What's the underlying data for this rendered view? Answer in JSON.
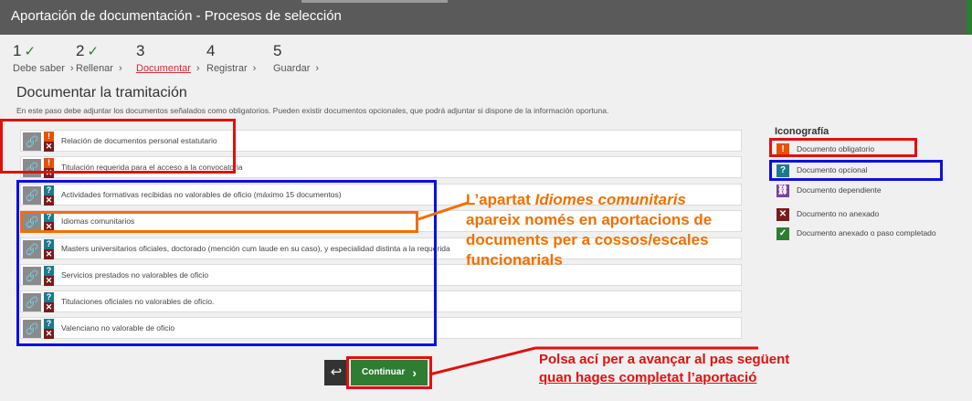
{
  "window": {
    "title": "Aportación de documentación - Procesos de selección"
  },
  "steps": [
    {
      "num": "1",
      "done": "✓",
      "label": "Debe saber",
      "sep": "›"
    },
    {
      "num": "2",
      "done": "✓",
      "label": "Rellenar",
      "sep": "›"
    },
    {
      "num": "3",
      "done": "",
      "label": "Documentar",
      "sep": "›"
    },
    {
      "num": "4",
      "done": "",
      "label": "Registrar",
      "sep": "›"
    },
    {
      "num": "5",
      "done": "",
      "label": "Guardar",
      "sep": "›"
    }
  ],
  "section": {
    "title": "Documentar la tramitación",
    "description": "En este paso debe adjuntar los documentos señalados como obligatorios. Pueden existir documentos opcionales, que podrá adjuntar si dispone de la información oportuna."
  },
  "documents": [
    {
      "label": "Relación de documentos personal estatutario",
      "type": "!"
    },
    {
      "label": "Titulación requerida para el acceso a la convocatoria",
      "type": "!"
    },
    {
      "label": "Actividades formativas recibidas no valorables de oficio (máximo 15 documentos)",
      "type": "?"
    },
    {
      "label": "Idiomas comunitarios",
      "type": "?"
    },
    {
      "label": "Masters universitarios oficiales, doctorado (mención cum laude en su caso), y especialidad distinta a la requerida",
      "type": "?"
    },
    {
      "label": "Servicios prestados no valorables de oficio",
      "type": "?"
    },
    {
      "label": "Titulaciones oficiales no valorables de oficio.",
      "type": "?"
    },
    {
      "label": "Valenciano no valorable de oficio",
      "type": "?"
    }
  ],
  "doc_icons": {
    "attach": "🔗",
    "missing": "✕"
  },
  "iconography": {
    "title": "Iconografía",
    "items": [
      {
        "icon": "!",
        "label": "Documento obligatorio",
        "color": "#e65100"
      },
      {
        "icon": "?",
        "label": "Documento opcional",
        "color": "#1c7a8c"
      },
      {
        "icon": "⛓",
        "label": "Documento dependiente",
        "color": "#7b3fa0"
      },
      {
        "icon": "✕",
        "label": "Documento no anexado",
        "color": "#7b1a1a"
      },
      {
        "icon": "✓",
        "label": "Documento anexado o paso completado",
        "color": "#2e7d32"
      }
    ]
  },
  "annotations": {
    "orange_pre": "L’apartat ",
    "orange_italic": "Idiomes comunitaris",
    "orange_post": " apareix només en aportacions de documents per a cossos/escales funcionarials",
    "red_pre": "Polsa ací per a avançar al pas següent ",
    "red_underline": "quan hages completat l’aportació"
  },
  "buttons": {
    "back": "↩",
    "continue": "Continuar",
    "continue_arrow": "›"
  }
}
